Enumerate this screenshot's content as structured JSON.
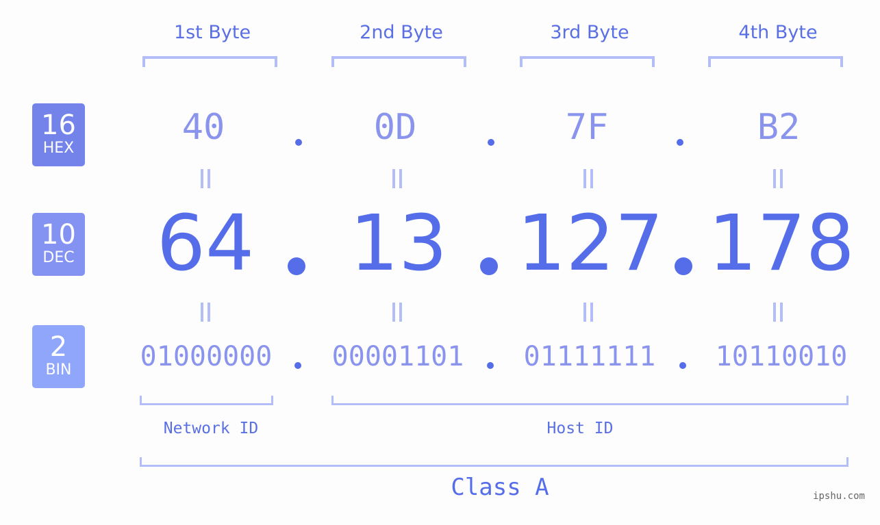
{
  "bytes": [
    {
      "label": "1st Byte",
      "hex": "40",
      "dec": "64",
      "bin": "01000000"
    },
    {
      "label": "2nd Byte",
      "hex": "0D",
      "dec": "13",
      "bin": "00001101"
    },
    {
      "label": "3rd Byte",
      "hex": "7F",
      "dec": "127",
      "bin": "01111111"
    },
    {
      "label": "4th Byte",
      "hex": "B2",
      "dec": "178",
      "bin": "10110010"
    }
  ],
  "badges": {
    "hex": {
      "num": "16",
      "label": "HEX",
      "color": "#7383ea"
    },
    "dec": {
      "num": "10",
      "label": "DEC",
      "color": "#8493f1"
    },
    "bin": {
      "num": "2",
      "label": "BIN",
      "color": "#8fa6fb"
    }
  },
  "network_id_label": "Network ID",
  "host_id_label": "Host ID",
  "class_label": "Class A",
  "brand": "ipshu.com",
  "colors": {
    "accent": "#566de9",
    "muted": "#8a94ec",
    "bracket": "#b3bdf7"
  }
}
